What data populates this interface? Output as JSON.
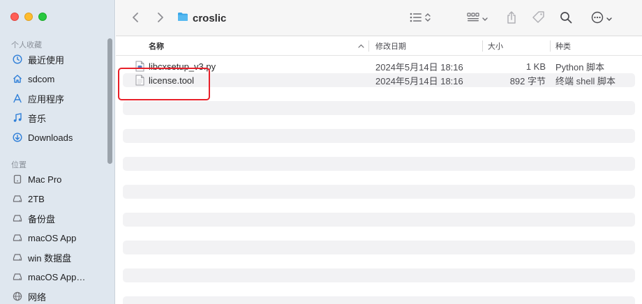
{
  "window": {
    "folder_title": "croslic"
  },
  "sidebar": {
    "favorites_header": "个人收藏",
    "favorites": [
      {
        "label": "最近使用",
        "icon": "clock-icon"
      },
      {
        "label": "sdcom",
        "icon": "home-icon"
      },
      {
        "label": "应用程序",
        "icon": "apps-icon"
      },
      {
        "label": "音乐",
        "icon": "music-icon"
      },
      {
        "label": "Downloads",
        "icon": "download-icon"
      }
    ],
    "locations_header": "位置",
    "locations": [
      {
        "label": "Mac Pro",
        "icon": "computer-icon"
      },
      {
        "label": "2TB",
        "icon": "drive-icon"
      },
      {
        "label": "备份盘",
        "icon": "drive-icon"
      },
      {
        "label": "macOS App",
        "icon": "drive-icon"
      },
      {
        "label": "win 数据盘",
        "icon": "drive-icon"
      },
      {
        "label": "macOS App…",
        "icon": "drive-icon"
      },
      {
        "label": "网络",
        "icon": "globe-icon"
      }
    ]
  },
  "columns": {
    "name": "名称",
    "modified": "修改日期",
    "size": "大小",
    "kind": "种类"
  },
  "files": [
    {
      "name": "libcxsetup_v3.py",
      "modified": "2024年5月14日 18:16",
      "size": "1 KB",
      "kind": "Python 脚本"
    },
    {
      "name": "license.tool",
      "modified": "2024年5月14日 18:16",
      "size": "892 字节",
      "kind": "终端 shell 脚本"
    }
  ],
  "colors": {
    "accent_folder": "#3aa7e8",
    "highlight_box": "#e8202a"
  }
}
